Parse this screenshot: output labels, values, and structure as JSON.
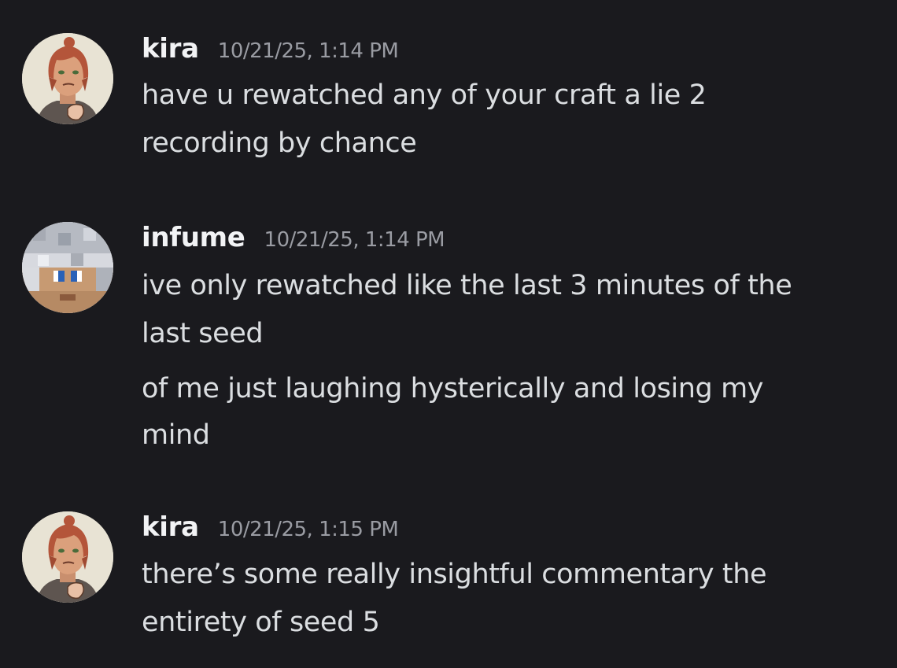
{
  "messages": [
    {
      "username": "kira",
      "timestamp": "10/21/25, 1:14 PM",
      "avatar_icon": "anime-character-avatar",
      "lines": [
        "have u rewatched any of your craft a lie 2",
        "recording by chance"
      ]
    },
    {
      "username": "infume",
      "timestamp": "10/21/25, 1:14 PM",
      "avatar_icon": "pixelated-minecraft-avatar",
      "lines": [
        "ive only rewatched like the last 3 minutes of the",
        "last seed",
        "of me just laughing hysterically and losing my",
        "mind"
      ]
    },
    {
      "username": "kira",
      "timestamp": "10/21/25, 1:15 PM",
      "avatar_icon": "anime-character-avatar",
      "lines": [
        "there’s some really insightful commentary the",
        "entirety of seed 5"
      ]
    }
  ],
  "colors": {
    "background": "#1a1a1e",
    "username": "#f2f3f5",
    "timestamp": "#9a9ca3",
    "text": "#dbdee1"
  }
}
